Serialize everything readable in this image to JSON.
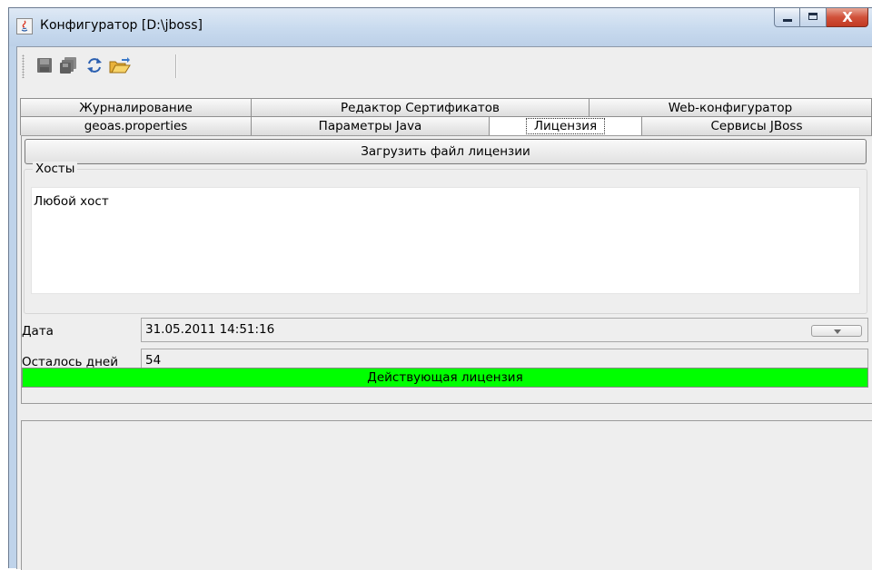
{
  "window": {
    "title": "Конфигуратор [D:\\jboss]",
    "close_glyph": "X"
  },
  "toolbar": {
    "buttons": [
      {
        "name": "save-icon"
      },
      {
        "name": "save-all-icon"
      },
      {
        "name": "refresh-icon"
      },
      {
        "name": "open-folder-icon"
      }
    ]
  },
  "tabs": {
    "row1": [
      "Журналирование",
      "Редактор Сертификатов",
      "Web-конфигуратор"
    ],
    "row2": [
      "geoas.properties",
      "Параметры Java",
      "Лицензия",
      "Сервисы JBoss"
    ],
    "selected": "Лицензия"
  },
  "license": {
    "load_button": "Загрузить файл лицензии",
    "hosts_label": "Хосты",
    "hosts": [
      "Любой хост"
    ],
    "date_label": "Дата",
    "date_value": "31.05.2011 14:51:16",
    "days_left_label": "Осталось дней",
    "days_left_value": "54",
    "status": "Действующая лицензия",
    "status_color": "#00ff00"
  }
}
